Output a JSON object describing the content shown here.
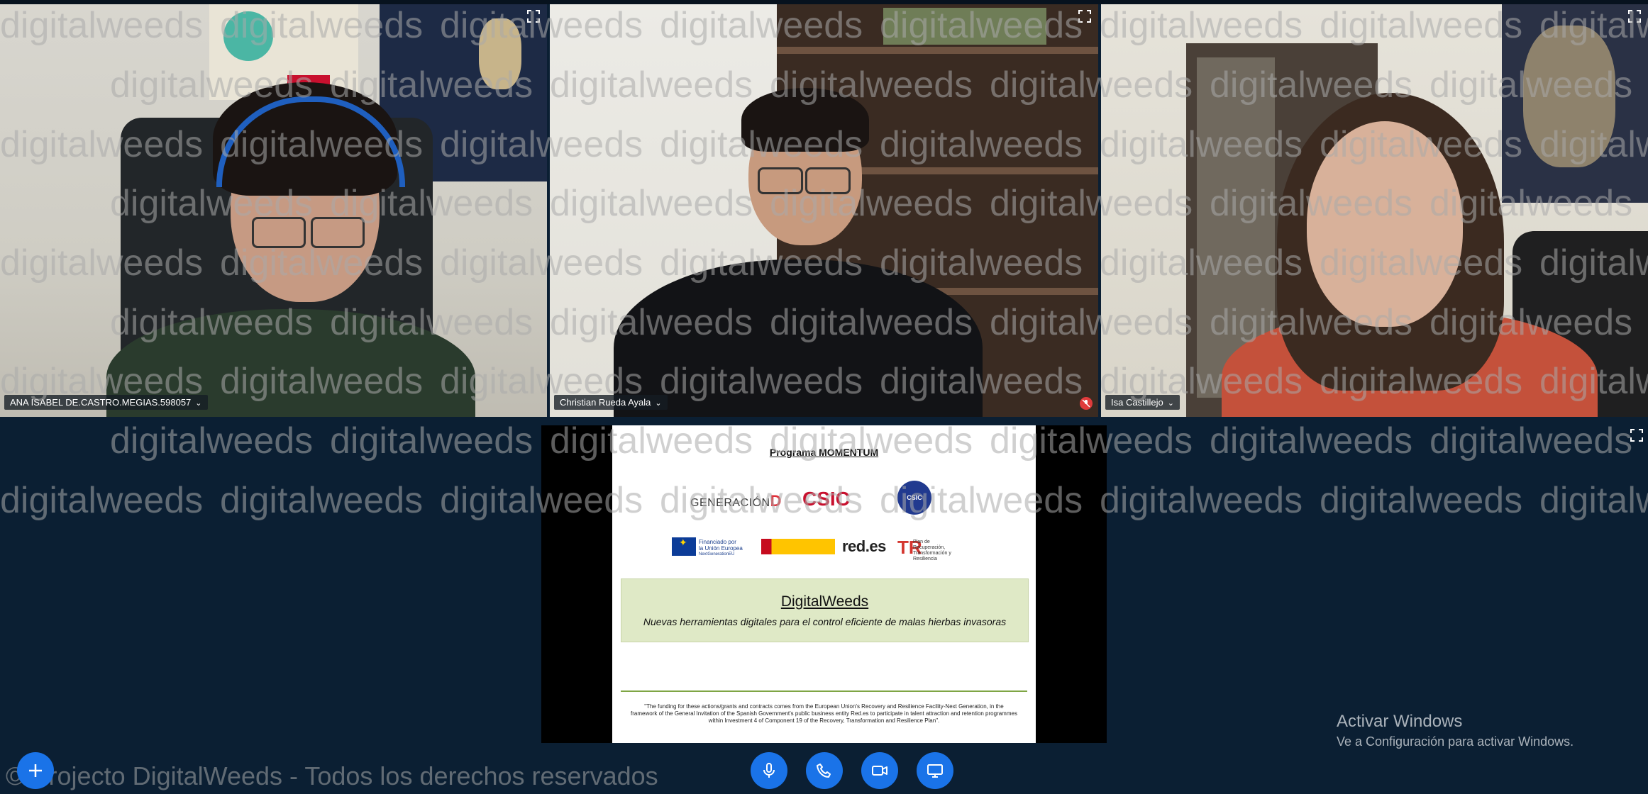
{
  "participants": [
    {
      "name": "ANA ISABEL DE.CASTRO.MEGIAS.598057",
      "muted": false
    },
    {
      "name": "Christian Rueda Ayala",
      "muted": true
    },
    {
      "name": "Isa Castillejo",
      "muted": false
    }
  ],
  "tile_icons": {
    "expand": "expand-icon",
    "dropdown": "chevron-down-icon",
    "mic_off": "mic-off-icon"
  },
  "shared_slide": {
    "title": "Programa MOMENTUM",
    "logos": {
      "generacion": "GENERACIÓN",
      "generacion_mark": "D",
      "csic": "CSIC",
      "seal": "CSIC",
      "eu_line1": "Financiado por",
      "eu_line2": "la Unión Europea",
      "eu_line3": "NextGenerationEU",
      "redes": "red.es",
      "recup_mark": "TR",
      "recup_text": "Plan de Recuperación, Transformación y Resiliencia"
    },
    "box_title": "DigitalWeeds",
    "box_subtitle": "Nuevas herramientas digitales para el control eficiente de malas hierbas invasoras",
    "footnote": "\"The funding for these actions/grants and contracts comes from the European Union's Recovery and Resilience Facility-Next Generation, in the framework of the General Invitation of the Spanish Government's public business entity Red.es to participate in talent attraction and retention programmes within Investment 4 of Component 19 of the Recovery, Transformation and Resilience Plan\"."
  },
  "watermark": "digitalweeds",
  "copyright": "© Projecto DigitalWeeds - Todos los derechos reservados",
  "windows_activation": {
    "title": "Activar Windows",
    "subtitle": "Ve a Configuración para activar Windows."
  },
  "controls": {
    "add": "add-icon",
    "mic": "microphone-icon",
    "hangup": "phone-icon",
    "video": "video-camera-icon",
    "share": "screen-share-icon"
  },
  "colors": {
    "background": "#0b1f33",
    "control_button": "#1a73e8",
    "slide_box": "#dfe9c6",
    "csic_red": "#c8102e",
    "mic_off_badge": "#e03b3b"
  }
}
